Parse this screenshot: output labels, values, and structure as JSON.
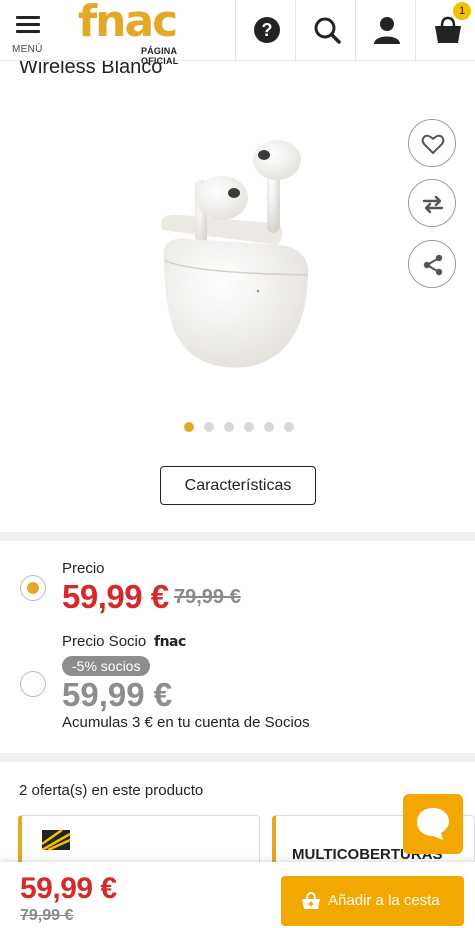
{
  "header": {
    "menu_label": "MENÚ",
    "logo_text": "fnac",
    "logo_sub": "PÁGINA OFICIAL",
    "cart_count": "1"
  },
  "product": {
    "title_partial": "Wireless Blanco",
    "gallery_dots": 6,
    "gallery_active": 0,
    "characteristics_label": "Características"
  },
  "pricing": {
    "precio_label": "Precio",
    "price": "59,99 €",
    "old_price": "79,99 €",
    "socio_label": "Precio Socio",
    "socio_logo": "fnac",
    "socio_badge": "-5% socios",
    "socio_price": "59,99 €",
    "accumulate_text": "Acumulas 3 € en tu cuenta de Socios",
    "selected_option": "precio"
  },
  "offers": {
    "title": "2 oferta(s) en este producto",
    "cards": [
      {
        "label": ""
      },
      {
        "label": "MULTICOBERTURAS"
      }
    ]
  },
  "bottom_bar": {
    "price": "59,99 €",
    "old_price": "79,99 €",
    "add_label": "Añadir a la cesta"
  },
  "colors": {
    "brand": "#e1a925",
    "price_red": "#d62a2a",
    "cta": "#f2a800"
  }
}
